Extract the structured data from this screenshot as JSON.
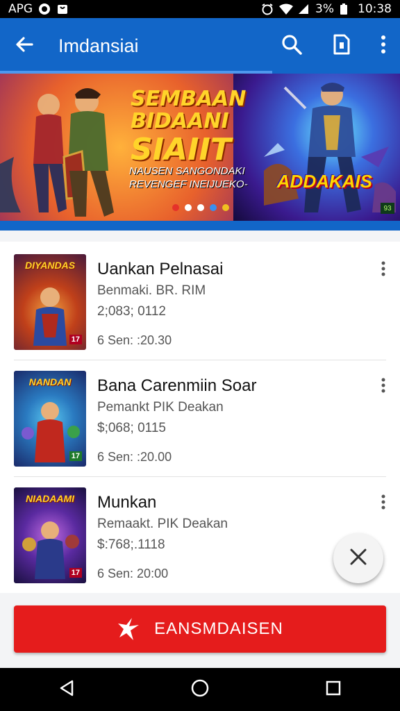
{
  "status_bar": {
    "left_text": "APG",
    "battery_text": "3%",
    "time": "10:38"
  },
  "app_bar": {
    "title": "Imdansiai",
    "back_icon": "arrow-left-icon",
    "search_icon": "search-icon",
    "share_icon": "document-icon",
    "menu_icon": "more-vert-icon"
  },
  "banner": {
    "headline_line1": "SEMBAAN",
    "headline_line2": "BIDAANI",
    "headline_line3": "SIAIIT",
    "subtitle_line1": "NAUSEN SANGONDAKI",
    "subtitle_line2": "REVENGEF INEIJUEKO-",
    "logo_text": "ADDAKAIS",
    "badge": "93",
    "dots": [
      "#e5312a",
      "#ffffff",
      "#ffffff",
      "#3a8ff0",
      "#f0c020"
    ]
  },
  "items": [
    {
      "thumb_title": "DIYANDAS",
      "thumb_age": "17",
      "name": "Uankan Pelnasai",
      "sub": "Benmaki. BR. RIM",
      "price": "2;083; 0112",
      "date": "6 Sen: :20.30"
    },
    {
      "thumb_title": "NANDAN",
      "thumb_age": "17",
      "name": "Bana Carenmiin Soar",
      "sub": "Pemankt PIK Deakan",
      "price": "$;068; 0115",
      "date": "6 Sen: :20.00"
    },
    {
      "thumb_title": "NIADAAMI",
      "thumb_age": "17",
      "name": "Munkan",
      "sub": "Remaakt. PIK Deakan",
      "price": "$:768;.1118",
      "date": "6 Sen: 20:00"
    }
  ],
  "cta": {
    "label": "EANSMDAISEN",
    "icon": "star-burst-icon"
  },
  "colors": {
    "primary": "#1266c8",
    "cta": "#e51c1c"
  }
}
